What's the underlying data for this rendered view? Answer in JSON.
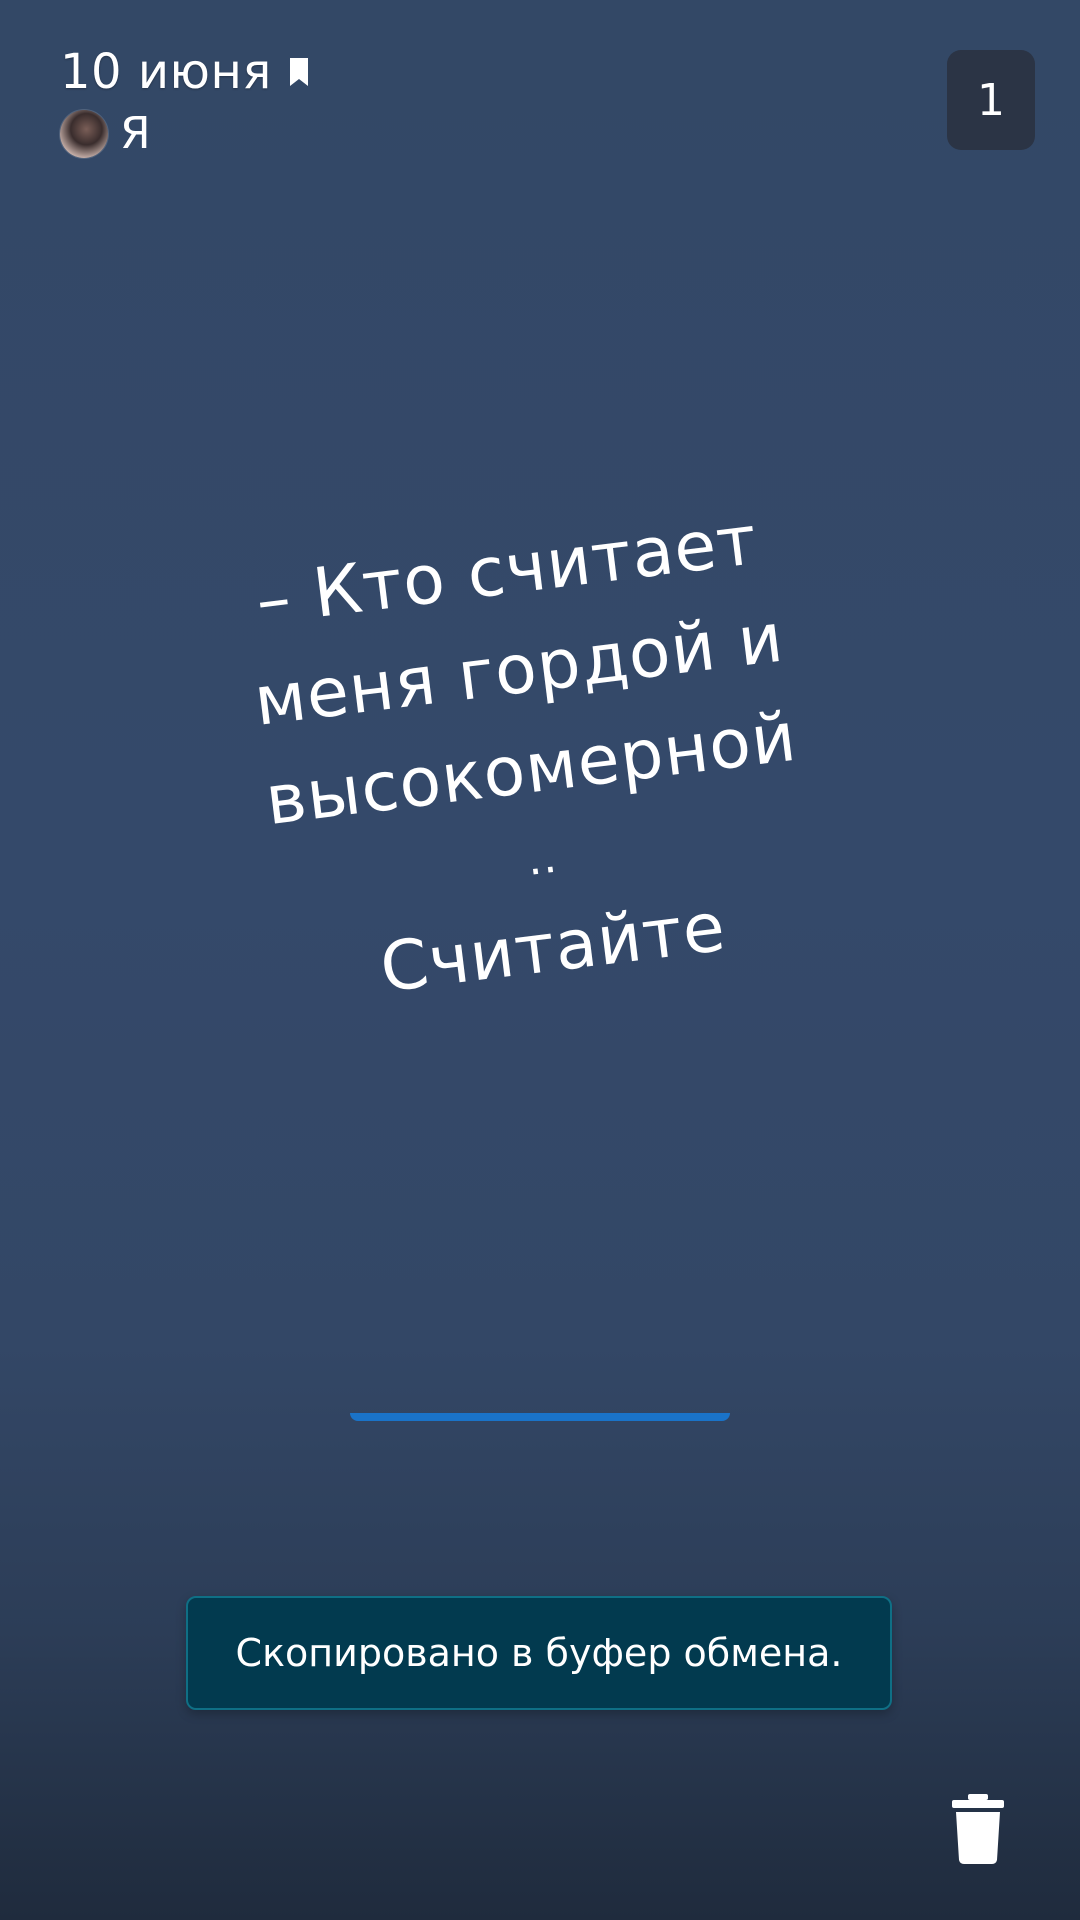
{
  "header": {
    "date": "10 июня",
    "author": "Я",
    "counter": "1"
  },
  "note": {
    "lines": [
      "– Кто считает",
      "меня гордой и",
      "высокомерной",
      "..",
      "Считайте"
    ]
  },
  "toast": {
    "message": "Скопировано в буфер обмена."
  },
  "icons": {
    "bookmark": "bookmark-icon",
    "delete": "trash-icon"
  },
  "colors": {
    "accent": "#1a73c8",
    "toast_bg": "#023a4f"
  }
}
